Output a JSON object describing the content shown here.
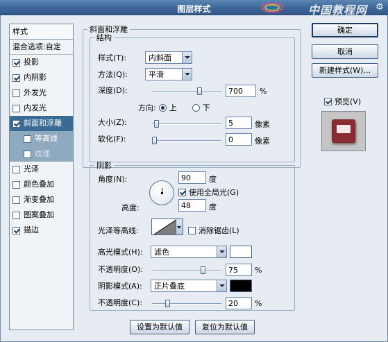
{
  "window": {
    "title": "图层样式",
    "watermark": "中国教程网"
  },
  "style_list": {
    "header": "样式",
    "blend_options": "混合选项:自定",
    "items": [
      {
        "label": "投影",
        "checked": true
      },
      {
        "label": "内阴影",
        "checked": true
      },
      {
        "label": "外发光",
        "checked": false
      },
      {
        "label": "内发光",
        "checked": false
      },
      {
        "label": "斜面和浮雕",
        "checked": true,
        "selected": true
      },
      {
        "label": "等高线",
        "checked": false,
        "sub": true
      },
      {
        "label": "纹理",
        "checked": false,
        "sub": true
      },
      {
        "label": "光泽",
        "checked": false
      },
      {
        "label": "颜色叠加",
        "checked": false
      },
      {
        "label": "渐变叠加",
        "checked": false
      },
      {
        "label": "图案叠加",
        "checked": false
      },
      {
        "label": "描边",
        "checked": true
      }
    ]
  },
  "bevel": {
    "group_title": "斜面和浮雕",
    "structure_title": "结构",
    "style_label": "样式(T):",
    "style_value": "内斜面",
    "technique_label": "方法(Q):",
    "technique_value": "平滑",
    "depth_label": "深度(D):",
    "depth_value": "700",
    "depth_unit": "%",
    "depth_level": 0.7,
    "direction_label": "方向:",
    "direction_up": "上",
    "direction_down": "下",
    "direction_selected": "up",
    "size_label": "大小(Z):",
    "size_value": "5",
    "size_unit": "像素",
    "size_level": 0.03,
    "soften_label": "软化(F):",
    "soften_value": "0",
    "soften_unit": "像素",
    "soften_level": 0.0
  },
  "shading": {
    "title": "阴影",
    "angle_label": "角度(N):",
    "angle_value": "90",
    "angle_unit": "度",
    "global_light_label": "使用全局光(G)",
    "global_light_checked": true,
    "altitude_label": "高度:",
    "altitude_value": "48",
    "altitude_unit": "度",
    "gloss_contour_label": "光泽等高线:",
    "antialias_label": "消除锯齿(L)",
    "antialias_checked": false,
    "highlight_mode_label": "高光模式(H):",
    "highlight_mode_value": "滤色",
    "highlight_color": "#ffffff",
    "highlight_opacity_label": "不透明度(O):",
    "highlight_opacity_value": "75",
    "highlight_opacity_level": 0.75,
    "shadow_mode_label": "阴影模式(A):",
    "shadow_mode_value": "正片叠底",
    "shadow_color": "#000000",
    "shadow_opacity_label": "不透明度(C):",
    "shadow_opacity_value": "20",
    "shadow_opacity_level": 0.2,
    "percent_unit": "%"
  },
  "bottom_buttons": {
    "set_default": "设置为默认值",
    "reset_default": "复位为默认值"
  },
  "right_panel": {
    "ok": "确定",
    "cancel": "取消",
    "new_style": "新建样式(W)...",
    "preview_label": "预览(V)",
    "preview_checked": true
  },
  "colors": {
    "accent": "#3a6b95",
    "preview_layer": "#8a2a33"
  }
}
